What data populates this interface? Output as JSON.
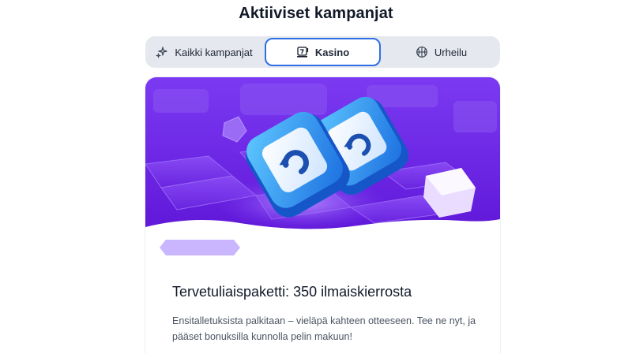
{
  "header": {
    "title": "Aktiiviset kampanjat"
  },
  "tabs": [
    {
      "label": "Kaikki kampanjat",
      "icon": "sparkles-icon",
      "selected": false
    },
    {
      "label": "Kasino",
      "icon": "slot-machine-icon",
      "selected": true
    },
    {
      "label": "Urheilu",
      "icon": "basketball-icon",
      "selected": false
    }
  ],
  "colors": {
    "accent": "#2f6fe4",
    "hero_purple": "#7a2df0",
    "badge": "#c9b6ff"
  },
  "promo": {
    "image_icon": "refresh-dice-icon",
    "title": "Tervetuliaispaketti: 350 ilmaiskierrosta",
    "description": "Ensitalletuksista palkitaan – vieläpä kahteen otteeseen. Tee ne nyt, ja pääset bonuksilla kunnolla pelin makuun!"
  }
}
